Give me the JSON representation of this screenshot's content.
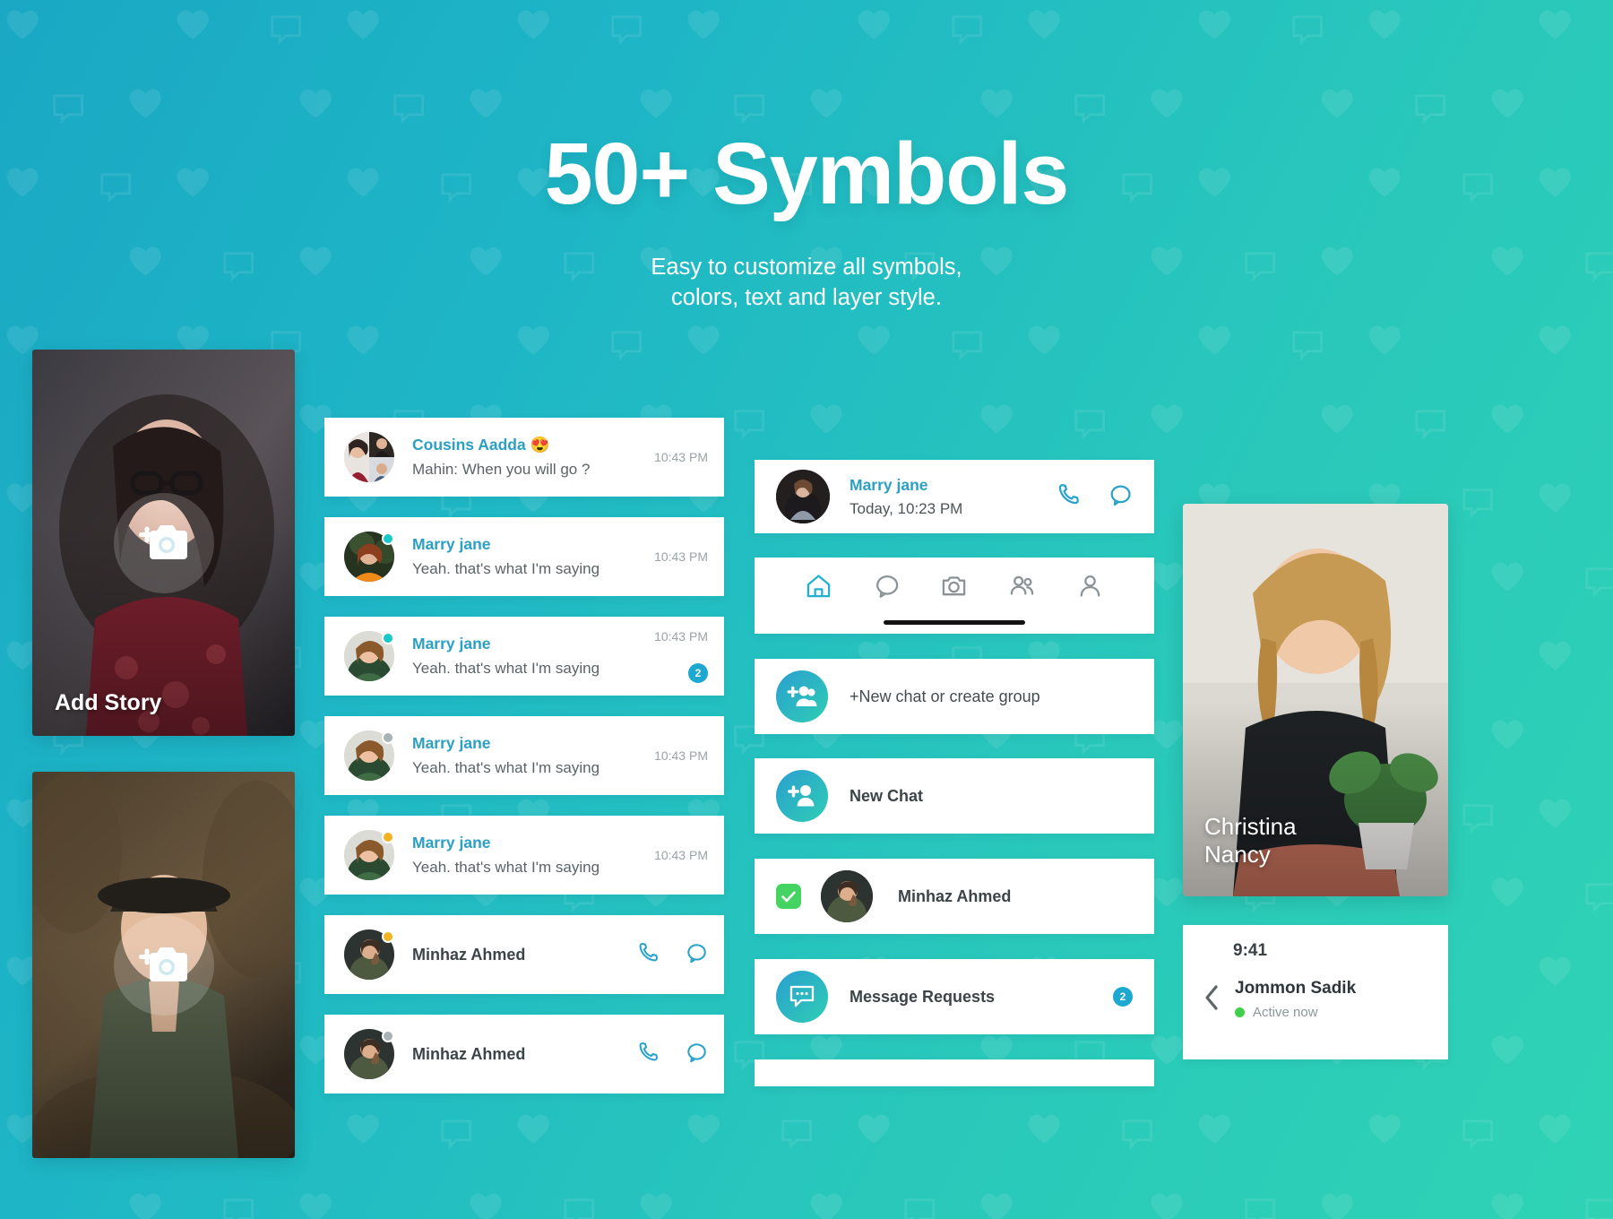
{
  "header": {
    "title": "50+ Symbols",
    "subtitle_line1": "Easy to customize all symbols,",
    "subtitle_line2": "colors, text and layer style."
  },
  "colors": {
    "bg_gradient_start": "#1aa8c4",
    "bg_gradient_end": "#2fd3b4",
    "accent_teal": "#2b9fc4",
    "badge_blue": "#1ca8d0",
    "online_green": "#3fcf4a",
    "check_green": "#45d362",
    "status_online": "#19c8c8",
    "status_offline": "#a9b2b4",
    "status_away": "#f0b323"
  },
  "stories": [
    {
      "label": "Add Story",
      "icon": "add-photo-icon"
    },
    {
      "label": "",
      "icon": "add-photo-icon"
    }
  ],
  "chat_list": [
    {
      "name": "Cousins Aadda 😍",
      "message": "Mahin: When you will go ?",
      "time": "10:43 PM",
      "badge": "",
      "status": "none",
      "type": "message"
    },
    {
      "name": "Marry jane",
      "message": "Yeah. that's what I'm saying",
      "time": "10:43 PM",
      "badge": "",
      "status": "online",
      "type": "message"
    },
    {
      "name": "Marry jane",
      "message": "Yeah. that's what I'm saying",
      "time": "10:43 PM",
      "badge": "2",
      "status": "online",
      "type": "message"
    },
    {
      "name": "Marry jane",
      "message": "Yeah. that's what I'm saying",
      "time": "10:43 PM",
      "badge": "",
      "status": "offline",
      "type": "message"
    },
    {
      "name": "Marry jane",
      "message": "Yeah. that's what I'm saying",
      "time": "10:43 PM",
      "badge": "",
      "status": "away",
      "type": "message"
    },
    {
      "name": "Minhaz Ahmed",
      "message": "",
      "time": "",
      "badge": "",
      "status": "away",
      "type": "contact"
    },
    {
      "name": "Minhaz Ahmed",
      "message": "",
      "time": "",
      "badge": "",
      "status": "offline",
      "type": "contact"
    }
  ],
  "conversation_header": {
    "name": "Marry jane",
    "time": "Today, 10:23 PM",
    "call_icon": "phone-icon",
    "message_icon": "chat-bubble-icon"
  },
  "nav_bar": {
    "items": [
      {
        "icon": "home-icon",
        "active": true
      },
      {
        "icon": "chat-bubble-icon",
        "active": false
      },
      {
        "icon": "camera-icon",
        "active": false
      },
      {
        "icon": "people-icon",
        "active": false
      },
      {
        "icon": "person-icon",
        "active": false
      }
    ]
  },
  "actions": [
    {
      "label": "+New chat or create group",
      "icon": "add-group-icon",
      "badge": ""
    },
    {
      "label": "New Chat",
      "icon": "add-person-icon",
      "badge": ""
    },
    {
      "label": "Minhaz Ahmed",
      "icon": "checkbox-checked-icon",
      "badge": "",
      "has_avatar": true
    },
    {
      "label": "Message Requests",
      "icon": "message-requests-icon",
      "badge": "2"
    }
  ],
  "profile_card": {
    "name_line1": "Christina",
    "name_line2": "Nancy"
  },
  "status_card": {
    "clock": "9:41",
    "name": "Jommon Sadik",
    "status": "Active now",
    "back_icon": "chevron-left-icon"
  }
}
